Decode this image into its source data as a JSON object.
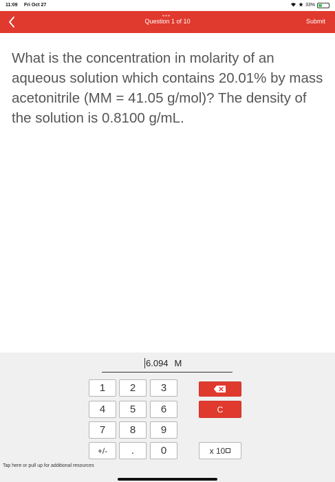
{
  "status_bar": {
    "time": "11:09",
    "date": "Fri Oct 27",
    "battery": "33%",
    "battery_level": 0.33,
    "icons": [
      "wifi-icon",
      "star-icon",
      "battery-icon"
    ]
  },
  "header": {
    "title": "Question 1 of 10",
    "submit_label": "Submit",
    "back_icon": "chevron-left-icon",
    "dots": "•••",
    "color": "#e03a2e"
  },
  "question": {
    "text": "What is the concentration in molarity of an aqueous solution which contains 20.01% by mass acetonitrile (MM = 41.05 g/mol)? The density of the solution is 0.8100 g/mL."
  },
  "answer": {
    "value": "6.094",
    "unit": "M"
  },
  "keypad": {
    "k1": "1",
    "k2": "2",
    "k3": "3",
    "k4": "4",
    "k5": "5",
    "k6": "6",
    "k7": "7",
    "k8": "8",
    "k9": "9",
    "sign": "+/-",
    "decimal": ".",
    "k0": "0",
    "clear": "C",
    "times_ten": "x 10",
    "backspace_icon": "backspace-icon"
  },
  "footer": {
    "hint": "Tap here or pull up for additional resources"
  }
}
